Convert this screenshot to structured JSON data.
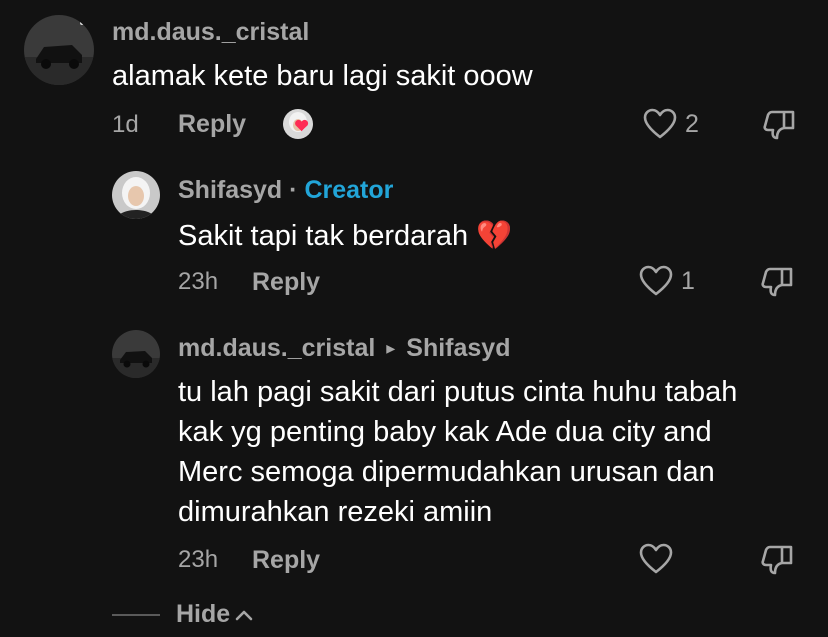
{
  "comments": [
    {
      "username": "md.daus._cristal",
      "text": "alamak kete baru lagi sakit ooow",
      "time": "1d",
      "reply_label": "Reply",
      "likes": "2"
    },
    {
      "username": "Shifasyd",
      "separator": "·",
      "creator_label": "Creator",
      "text": "Sakit tapi tak berdarah",
      "emoji": "💔",
      "time": "23h",
      "reply_label": "Reply",
      "likes": "1"
    },
    {
      "username": "md.daus._cristal",
      "reply_to_arrow": "▸",
      "reply_to": "Shifasyd",
      "text_lines": [
        "tu lah pagi sakit dari putus cinta huhu tabah",
        "kak yg penting baby kak Ade dua city and",
        "Merc semoga dipermudahkan urusan dan",
        "dimurahkan rezeki amiin"
      ],
      "time": "23h",
      "reply_label": "Reply",
      "likes": ""
    }
  ],
  "hide_label": "Hide",
  "colors": {
    "background": "#121212",
    "text": "#ffffff",
    "muted": "#a6a6a6",
    "creator": "#22a5d8",
    "liked_heart": "#fe2c55"
  },
  "icons": [
    "heart-icon",
    "dislike-icon",
    "chevron-up-icon",
    "broken-heart-icon"
  ]
}
